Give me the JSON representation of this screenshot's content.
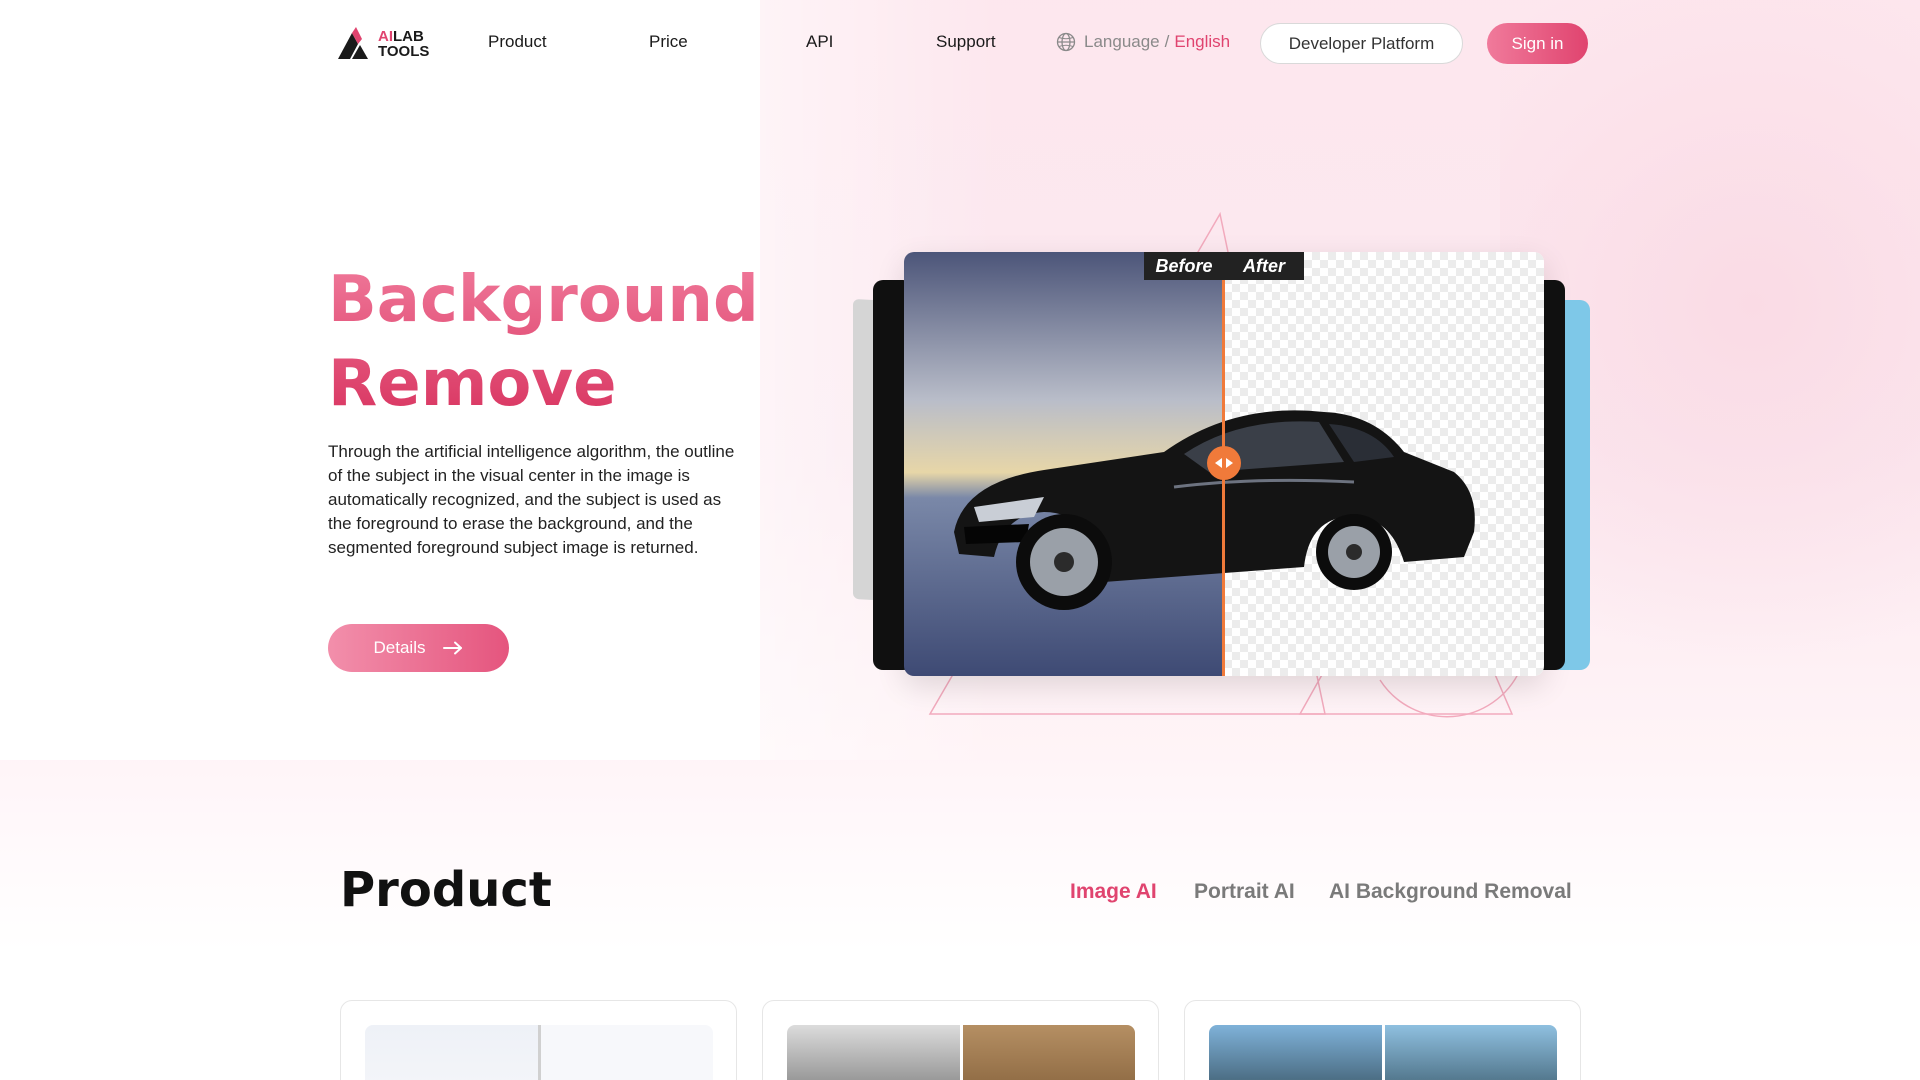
{
  "nav": {
    "logo_ai": "AI",
    "logo_lab": "LAB",
    "logo_tools": "TOOLS",
    "links": [
      "Product",
      "Price",
      "API",
      "Support"
    ],
    "language_label": "Language",
    "language_sep": "/",
    "language_current": "English",
    "developer_platform": "Developer Platform",
    "sign_in": "Sign in"
  },
  "hero": {
    "title_line1": "Background",
    "title_line2": "Remove",
    "description": "Through the artificial intelligence algorithm, the outline of the subject in the visual center in the image is automatically recognized, and the subject is used as the foreground to erase the background, and the segmented foreground subject image is returned.",
    "details_button": "Details",
    "before_label": "Before",
    "after_label": "After"
  },
  "product": {
    "title": "Product",
    "tabs": [
      {
        "label": "Image AI",
        "active": true
      },
      {
        "label": "Portrait AI",
        "active": false
      },
      {
        "label": "AI Background Removal",
        "active": false
      }
    ]
  },
  "colors": {
    "accent": "#e0446f",
    "accent_light": "#f07a9b",
    "slider": "#f07a3a"
  }
}
